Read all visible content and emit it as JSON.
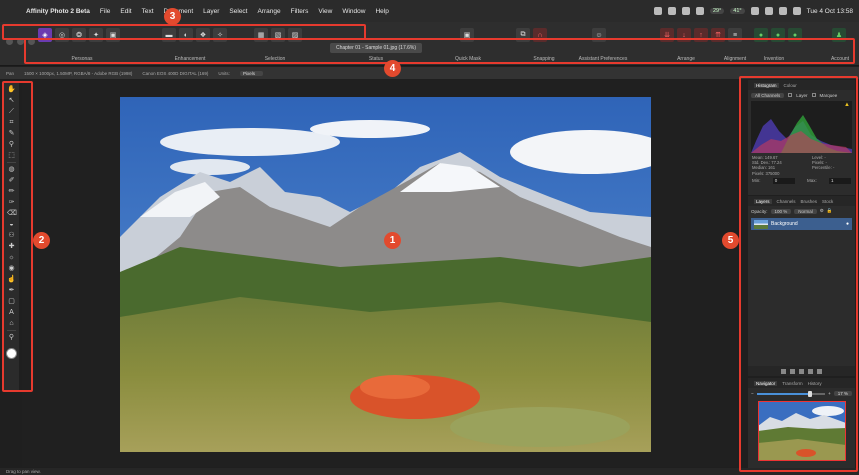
{
  "menubar": {
    "app_name": "Affinity Photo 2 Beta",
    "items": [
      "File",
      "Edit",
      "Text",
      "Document",
      "Layer",
      "Select",
      "Arrange",
      "Filters",
      "View",
      "Window",
      "Help"
    ],
    "clock": "Tue 4 Oct 13:58",
    "status_pills": [
      "29°",
      "41°"
    ]
  },
  "toolbar": {
    "labels": {
      "personas": "Personas",
      "enhancement": "Enhancement",
      "selection": "Selection",
      "status": "Status",
      "quick_mask": "Quick Mask",
      "snapping": "Snapping",
      "assistant": "Assistant Preferences",
      "arrange": "Arrange",
      "alignment": "Alignment",
      "invention": "Invention",
      "account": "Account"
    },
    "document_title": "Chapter 01 - Sample 01.jpg (17.6%)"
  },
  "contextbar": {
    "tool": "Pan",
    "info": "1500 × 1000px, 1.50MP, RGBA/8 - Adobe RGB (1998)",
    "camera": "Canon EOS 400D DIGITAL (169)",
    "units_label": "Units:",
    "units_value": "Pixels"
  },
  "histogram": {
    "tabs": [
      "Histogram",
      "Colour"
    ],
    "channel": "All Channels",
    "layer_label": "Layer",
    "marquee_label": "Marquee",
    "stats": [
      [
        "Mean: 149.67",
        "Level: -"
      ],
      [
        "Std. Dev.: 77.24",
        "Pixels: -"
      ],
      [
        "Median: 161",
        "Percentile: -"
      ],
      [
        "Pixels: 375000",
        ""
      ]
    ],
    "min_label": "Min:",
    "min_value": "0",
    "max_label": "Max:",
    "max_value": "1"
  },
  "layers": {
    "tabs": [
      "Layers",
      "Channels",
      "Brushes",
      "Stock"
    ],
    "opacity_label": "Opacity:",
    "opacity_value": "100 %",
    "blend_mode": "Normal",
    "layer_name": "Background"
  },
  "navigator": {
    "tabs": [
      "Navigator",
      "Transform",
      "History"
    ],
    "zoom": "17 %",
    "zoom_fraction": 0.78
  },
  "statusbar": {
    "text": "Drag to pan view."
  },
  "badges": [
    "1",
    "2",
    "3",
    "4",
    "5"
  ],
  "colors": {
    "highlight": "#e63a2e",
    "badge": "#e24a2e",
    "layer_selected": "#3c5f8f"
  }
}
